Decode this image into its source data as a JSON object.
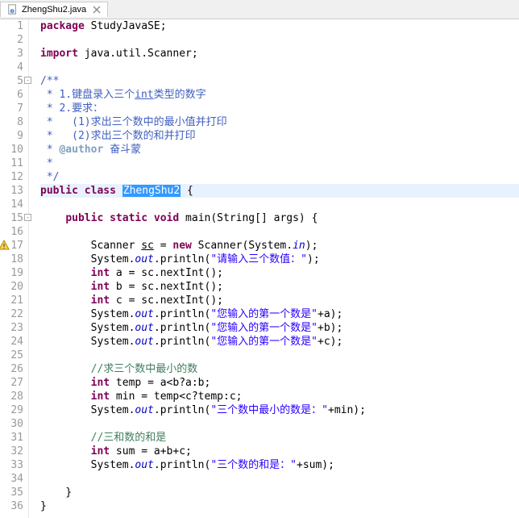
{
  "tab": {
    "filename": "ZhengShu2.java"
  },
  "lines": [
    {
      "n": 1,
      "html": "<span class='kw'>package</span> StudyJavaSE;"
    },
    {
      "n": 2,
      "html": ""
    },
    {
      "n": 3,
      "html": "<span class='kw'>import</span> java.util.Scanner;"
    },
    {
      "n": 4,
      "html": ""
    },
    {
      "n": 5,
      "fold": true,
      "html": "<span class='doc'>/**</span>"
    },
    {
      "n": 6,
      "html": "<span class='doc'> * 1.键盘录入三个</span><span class='doc'><u>int</u></span><span class='doc'>类型的数字</span>"
    },
    {
      "n": 7,
      "html": "<span class='doc'> * 2.要求：</span>"
    },
    {
      "n": 8,
      "html": "<span class='doc'> *   (1)求出三个数中的最小值并打印</span>"
    },
    {
      "n": 9,
      "html": "<span class='doc'> *   (2)求出三个数的和并打印</span>"
    },
    {
      "n": 10,
      "html": "<span class='doc'> * </span><span class='doctag'>@author</span><span class='doc'> 奋斗蒙</span>"
    },
    {
      "n": 11,
      "html": "<span class='doc'> *</span>"
    },
    {
      "n": 12,
      "html": "<span class='doc'> */</span>"
    },
    {
      "n": 13,
      "hl": true,
      "html": "<span class='kw'>public</span> <span class='kw'>class</span> <span class='sel'>ZhengShu2</span> {"
    },
    {
      "n": 14,
      "html": ""
    },
    {
      "n": 15,
      "fold": true,
      "html": "    <span class='kw'>public</span> <span class='kw'>static</span> <span class='kw'>void</span> main(String[] args) {"
    },
    {
      "n": 16,
      "html": ""
    },
    {
      "n": 17,
      "warn": true,
      "html": "        Scanner <u>sc</u> = <span class='kw'>new</span> Scanner(System.<span class='fld'>in</span>);"
    },
    {
      "n": 18,
      "html": "        System.<span class='fld'>out</span>.println(<span class='str'>\"请输入三个数值：\"</span>);"
    },
    {
      "n": 19,
      "html": "        <span class='kw'>int</span> a = sc.nextInt();"
    },
    {
      "n": 20,
      "html": "        <span class='kw'>int</span> b = sc.nextInt();"
    },
    {
      "n": 21,
      "html": "        <span class='kw'>int</span> c = sc.nextInt();"
    },
    {
      "n": 22,
      "html": "        System.<span class='fld'>out</span>.println(<span class='str'>\"您输入的第一个数是\"</span>+a);"
    },
    {
      "n": 23,
      "html": "        System.<span class='fld'>out</span>.println(<span class='str'>\"您输入的第一个数是\"</span>+b);"
    },
    {
      "n": 24,
      "html": "        System.<span class='fld'>out</span>.println(<span class='str'>\"您输入的第一个数是\"</span>+c);"
    },
    {
      "n": 25,
      "html": ""
    },
    {
      "n": 26,
      "html": "        <span class='cm'>//求三个数中最小的数</span>"
    },
    {
      "n": 27,
      "html": "        <span class='kw'>int</span> temp = a&lt;b?a:b;"
    },
    {
      "n": 28,
      "html": "        <span class='kw'>int</span> min = temp&lt;c?temp:c;"
    },
    {
      "n": 29,
      "html": "        System.<span class='fld'>out</span>.println(<span class='str'>\"三个数中最小的数是：\"</span>+min);"
    },
    {
      "n": 30,
      "html": ""
    },
    {
      "n": 31,
      "html": "        <span class='cm'>//三和数的和是</span>"
    },
    {
      "n": 32,
      "html": "        <span class='kw'>int</span> sum = a+b+c;"
    },
    {
      "n": 33,
      "html": "        System.<span class='fld'>out</span>.println(<span class='str'>\"三个数的和是：\"</span>+sum);"
    },
    {
      "n": 34,
      "html": ""
    },
    {
      "n": 35,
      "html": "    }"
    },
    {
      "n": 36,
      "html": "}"
    }
  ]
}
